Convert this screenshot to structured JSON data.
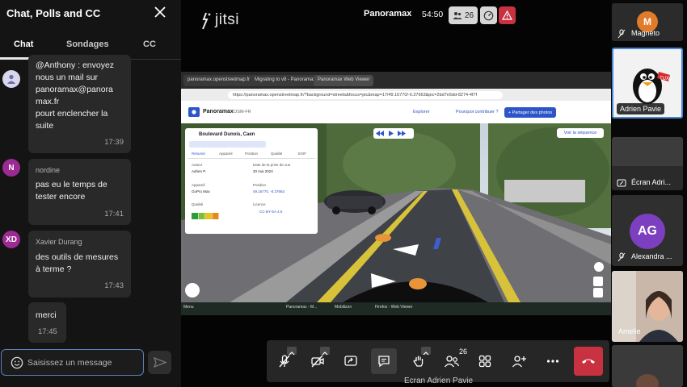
{
  "chat": {
    "title": "Chat, Polls and CC",
    "tabs": [
      "Chat",
      "Sondages",
      "CC"
    ],
    "messages": [
      {
        "sender": "",
        "lines": [
          "@Anthony : envoyez",
          "nous un mail sur",
          "panoramax@panora",
          "max.fr",
          " pourt enclencher la",
          "suite"
        ],
        "time": "17:39",
        "avatar": "",
        "avatar_color": "#d8d8ec"
      },
      {
        "sender": "nordine",
        "lines": [
          "pas eu le temps de",
          "tester encore"
        ],
        "time": "17:41",
        "avatar": "N",
        "avatar_color": "#9b2a92"
      },
      {
        "sender": "Xavier Durang",
        "lines": [
          "des outils de mesures",
          "à terme ?"
        ],
        "time": "17:43",
        "avatar": "XD",
        "avatar_color": "#9b2a92"
      },
      {
        "sender": "",
        "lines": [
          "merci"
        ],
        "time": "17:45",
        "avatar": "",
        "avatar_color": ""
      }
    ],
    "composer_placeholder": "Saisissez un message"
  },
  "stage": {
    "logo": "jitsi",
    "room": "Panoramax",
    "timer": "54:50",
    "participants": "26",
    "toolbar_participants": "26",
    "speaker_label": "Ecran Adrien Pavie"
  },
  "shared_screen": {
    "browser_tabs": [
      "panoramax.openstreetmap.fr",
      "Migrating to v8 - Panoramax",
      "Panoramax Web Viewer"
    ],
    "url": "https://panoramax.openstreetmap.fr/?background=streets&focus=pic&map=17/49.16770/-0.37663&pic=2bd7e5dd-8274-4f7f",
    "app_name": "Panoramax",
    "app_tag": "OSM-FR",
    "links": [
      "Explorer",
      "Pourquoi contribuer ?"
    ],
    "share_button": "+ Partager des photos",
    "card": {
      "title": "Boulevard Dunois, Caen",
      "tabs": [
        "Résumé",
        "Appareil",
        "Position",
        "Qualité",
        "EXIF"
      ],
      "author_label": "Auteur",
      "author": "Adrien P.",
      "date_label": "Date de la prise de vue",
      "date": "20 mai 2024",
      "device_label": "Appareil",
      "device": "GoPro Max",
      "position_label": "Position",
      "position": "49.16770, -0.37663",
      "quality_label": "Qualité",
      "license_label": "Licence",
      "license": "CC-BY-SA 4.0"
    },
    "sequence_button": "Voir la séquence",
    "taskbar_items": [
      "Menu",
      "Panoramax - M...",
      "Mobilizon",
      "Firefox - Web Viewer"
    ]
  },
  "filmstrip": [
    {
      "name": "Magnéto",
      "initial": "M",
      "color": "#e07b2a"
    },
    {
      "name": "Adrien Pavie",
      "speaking": true
    },
    {
      "name": "Écran Adri..."
    },
    {
      "name": "Alexandra ...",
      "initial": "AG",
      "color": "#7b3fc0"
    },
    {
      "name": "Amelie"
    },
    {
      "name": ""
    }
  ],
  "colors": {
    "accent": "#4a86d8",
    "hangup": "#c8313f",
    "avatar_purple": "#9b2a92"
  }
}
